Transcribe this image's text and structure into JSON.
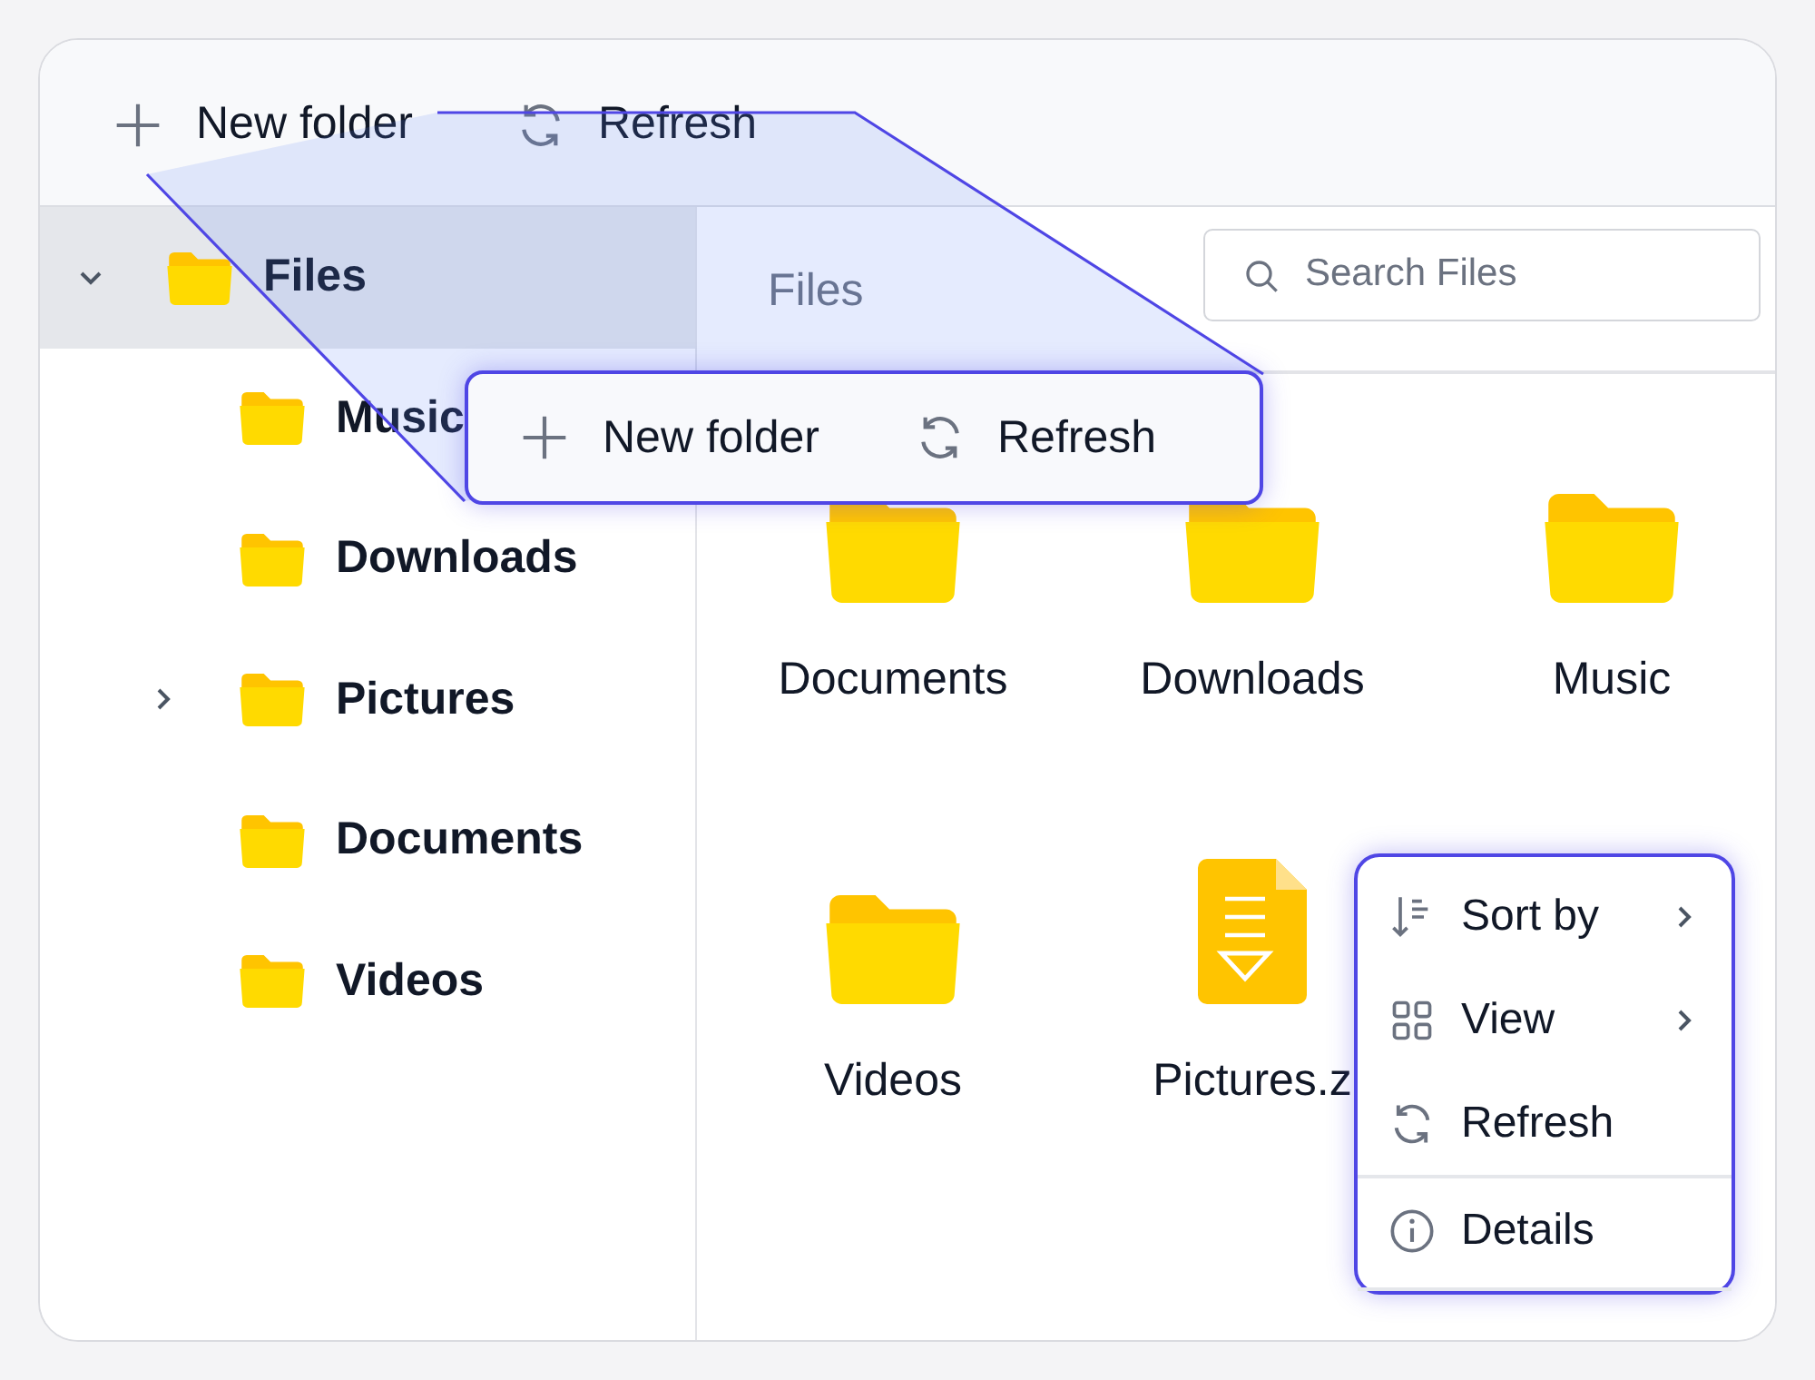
{
  "toolbar": {
    "buttons": [
      {
        "label": "New folder"
      },
      {
        "label": "Refresh"
      }
    ]
  },
  "tree": {
    "items": [
      {
        "label": "Files",
        "selected": true,
        "expandable": true,
        "expanded": true,
        "children": [
          {
            "label": "Music",
            "selected": false,
            "expandable": false
          },
          {
            "label": "Downloads",
            "selected": false,
            "expandable": false
          },
          {
            "label": "Pictures",
            "selected": false,
            "expandable": true,
            "expanded": false
          },
          {
            "label": "Documents",
            "selected": false,
            "expandable": false
          },
          {
            "label": "Videos",
            "selected": false,
            "expandable": false
          }
        ]
      }
    ]
  },
  "pane": {
    "title": "Files",
    "search": {
      "placeholder": "Search Files"
    },
    "items": [
      {
        "name": "Documents",
        "kind": "folder"
      },
      {
        "name": "Downloads",
        "kind": "folder"
      },
      {
        "name": "Music",
        "kind": "folder"
      },
      {
        "name": "Videos",
        "kind": "folder"
      },
      {
        "name": "Pictures.z",
        "kind": "archive"
      }
    ]
  },
  "callout": {
    "buttons": [
      {
        "label": "New folder"
      },
      {
        "label": "Refresh"
      }
    ]
  },
  "context_menu": {
    "items": [
      {
        "label": "Sort by",
        "submenu": true,
        "separator_before": false
      },
      {
        "label": "View",
        "submenu": true,
        "separator_before": false
      },
      {
        "label": "Refresh",
        "submenu": false,
        "separator_before": false
      },
      {
        "label": "Details",
        "submenu": false,
        "separator_before": true
      }
    ]
  }
}
